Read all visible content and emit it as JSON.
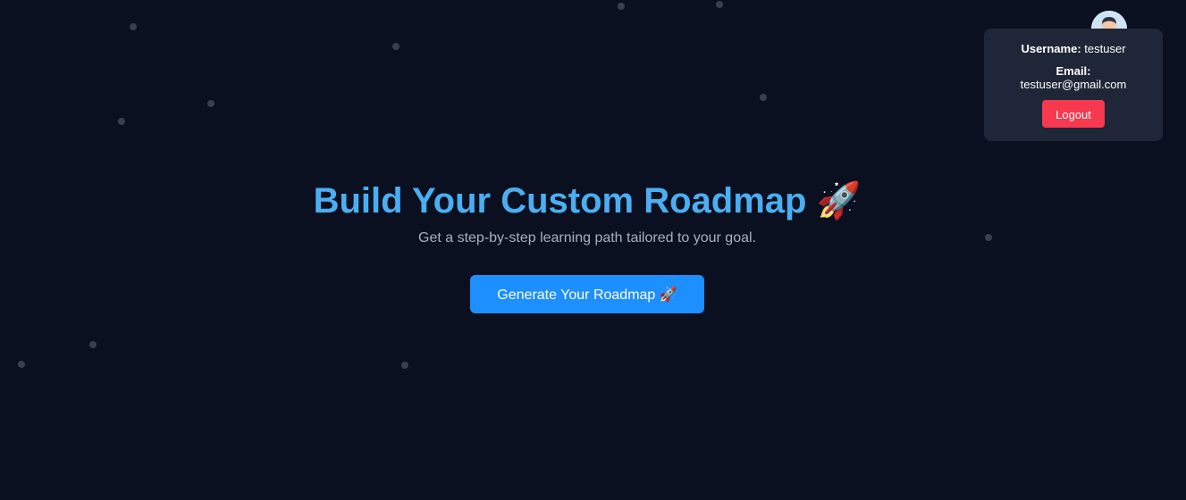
{
  "hero": {
    "title": "Build Your Custom Roadmap",
    "title_emoji": "🚀",
    "subtitle": "Get a step-by-step learning path tailored to your goal.",
    "cta_label": "Generate Your Roadmap 🚀"
  },
  "profile": {
    "username_label": "Username:",
    "username": "testuser",
    "email_label": "Email:",
    "email": "testuser@gmail.com",
    "logout_label": "Logout"
  },
  "colors": {
    "background": "#0b1020",
    "accent_title": "#4aaef2",
    "cta": "#1e8fff",
    "logout": "#f6394f",
    "card": "#1f2637"
  },
  "icons": {
    "avatar": "user-avatar-icon",
    "title_emoji": "rocket-icon"
  }
}
